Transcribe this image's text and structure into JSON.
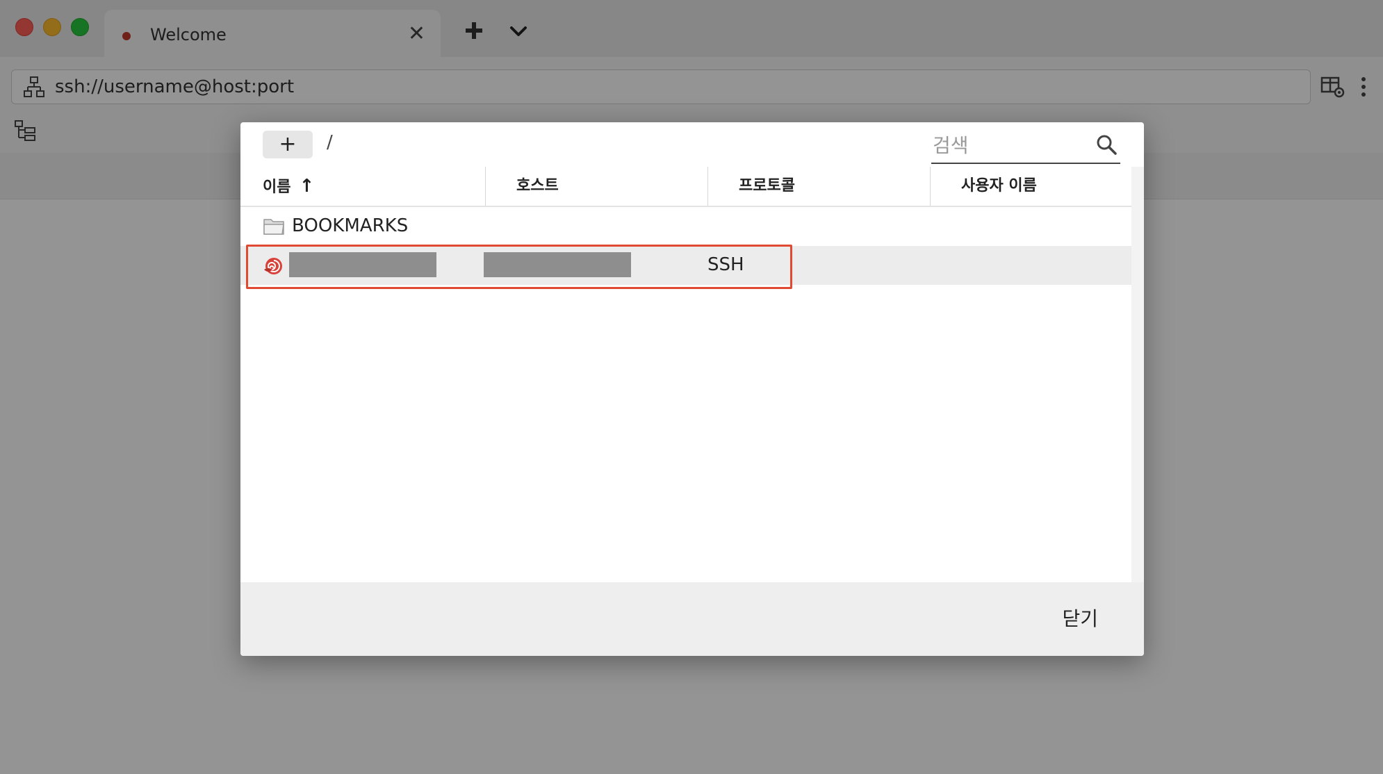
{
  "window": {
    "tab_title": "Welcome",
    "address_value": "ssh://username@host:port"
  },
  "dialog": {
    "add_label": "+",
    "path": "/",
    "search_placeholder": "검색",
    "columns": {
      "name": "이름",
      "sort_indicator": "↑",
      "host": "호스트",
      "protocol": "프로토콜",
      "username": "사용자 이름"
    },
    "rows": [
      {
        "type": "folder",
        "name": "BOOKMARKS"
      },
      {
        "type": "bookmark",
        "protocol": "SSH"
      }
    ],
    "close_label": "닫기"
  },
  "icons": {
    "tab_status": "status-dot-icon",
    "new_tab": "plus-icon",
    "tab_menu": "chevron-down-icon",
    "address": "network-icon",
    "table_settings": "table-settings-icon",
    "more": "more-vertical-icon",
    "tree": "tree-view-icon",
    "search": "search-icon",
    "folder": "folder-open-icon",
    "bookmark": "shell-icon"
  },
  "colors": {
    "highlight": "#e04a33",
    "traffic_red": "#ff5f57",
    "traffic_yellow": "#febc2e",
    "traffic_green": "#28c840",
    "tab_dot": "#c0392b"
  }
}
